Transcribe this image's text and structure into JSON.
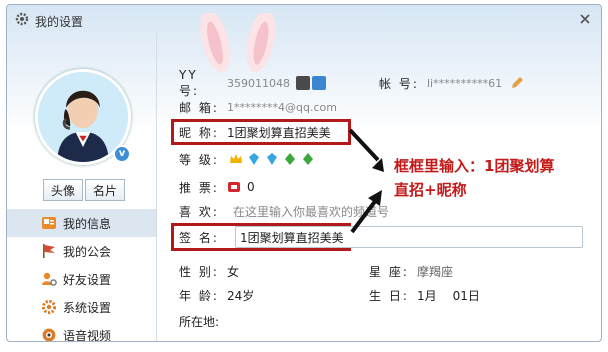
{
  "window": {
    "title": "我的设置"
  },
  "sidebar": {
    "avatar_button": "头像",
    "card_button": "名片",
    "items": [
      {
        "label": "我的信息"
      },
      {
        "label": "我的公会"
      },
      {
        "label": "好友设置"
      },
      {
        "label": "系统设置"
      },
      {
        "label": "语音视频"
      }
    ]
  },
  "profile": {
    "yy_label": "YY 号:",
    "yy_value": "359011048",
    "account_label": "帐 号:",
    "account_value": "li**********61",
    "email_label": "邮 箱:",
    "email_value": "1********4@qq.com",
    "nickname_label": "昵 称:",
    "nickname_value": "1团聚划算直招美美",
    "level_label": "等 级:",
    "tickets_label": "推 票:",
    "tickets_value": "0",
    "likes_label": "喜 欢:",
    "likes_placeholder": "在这里输入你最喜欢的频道号",
    "signature_label": "签 名:",
    "signature_value": "1团聚划算直招美美",
    "gender_label": "性 别:",
    "gender_value": "女",
    "zodiac_label": "星 座:",
    "zodiac_value": "摩羯座",
    "age_label": "年 龄:",
    "age_value": "24岁",
    "birthday_label": "生 日:",
    "birthday_month": "1月",
    "birthday_day": "01日",
    "location_label": "所在地:"
  },
  "annotation": {
    "line1": "框框里输入：1团聚划算",
    "line2": "直招+昵称"
  },
  "colors": {
    "highlight": "#b21a1a",
    "annotation": "#c31a1a"
  }
}
